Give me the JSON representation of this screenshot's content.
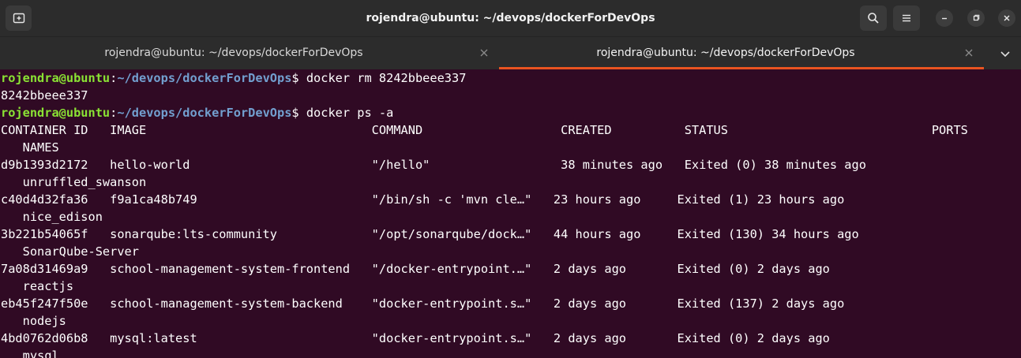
{
  "window": {
    "title": "rojendra@ubuntu: ~/devops/dockerForDevOps",
    "icons": {
      "new_tab": "new-tab-icon",
      "search": "search-icon",
      "menu": "hamburger-menu-icon",
      "minimize": "minimize-icon",
      "maximize": "maximize-icon",
      "close": "close-icon"
    }
  },
  "tabs": [
    {
      "label": "rojendra@ubuntu: ~/devops/dockerForDevOps",
      "active": false
    },
    {
      "label": "rojendra@ubuntu: ~/devops/dockerForDevOps",
      "active": true
    }
  ],
  "colors": {
    "background": "#300a24",
    "prompt_user": "#8ae234",
    "prompt_path": "#729fcf",
    "text": "#ffffff",
    "active_tab_accent": "#e95420"
  },
  "terminal": {
    "prompt_user": "rojendra@ubuntu",
    "prompt_sep": ":",
    "prompt_path": "~/devops/dockerForDevOps",
    "prompt_end": "$ ",
    "commands": [
      "docker rm 8242bbeee337",
      "docker ps -a"
    ],
    "output_rm": "8242bbeee337",
    "ps_lines": [
      "CONTAINER ID   IMAGE                               COMMAND                   CREATED          STATUS                            PORTS",
      "   NAMES",
      "d9b1393d2172   hello-world                         \"/hello\"                  38 minutes ago   Exited (0) 38 minutes ago",
      "   unruffled_swanson",
      "c40d4d32fa36   f9a1ca48b749                        \"/bin/sh -c 'mvn cle…\"   23 hours ago     Exited (1) 23 hours ago",
      "   nice_edison",
      "3b221b54065f   sonarqube:lts-community             \"/opt/sonarqube/dock…\"   44 hours ago     Exited (130) 34 hours ago",
      "   SonarQube-Server",
      "7a08d31469a9   school-management-system-frontend   \"/docker-entrypoint.…\"   2 days ago       Exited (0) 2 days ago",
      "   reactjs",
      "eb45f247f50e   school-management-system-backend    \"docker-entrypoint.s…\"   2 days ago       Exited (137) 2 days ago",
      "   nodejs",
      "4bd0762d06b8   mysql:latest                        \"docker-entrypoint.s…\"   2 days ago       Exited (0) 2 days ago",
      "   mysql"
    ]
  }
}
